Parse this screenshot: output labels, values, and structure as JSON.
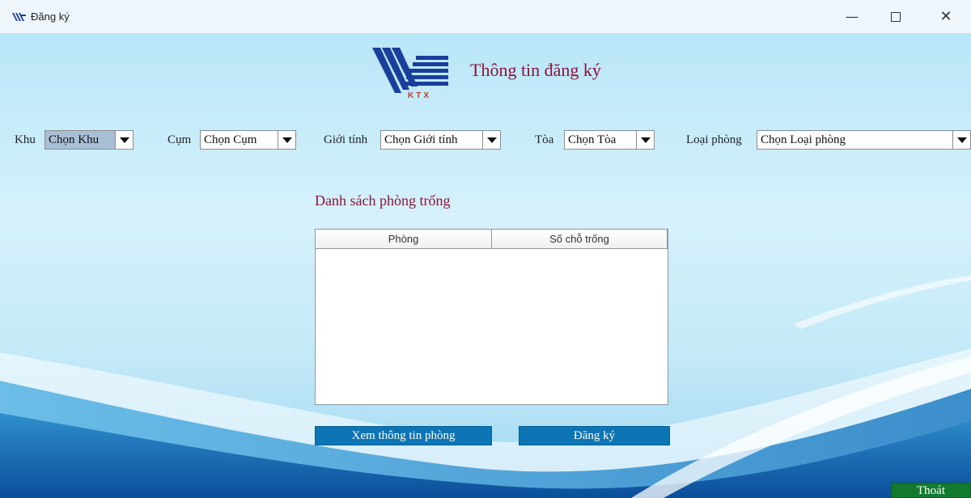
{
  "window": {
    "title": "Đăng ký",
    "min_icon": "minimize-icon",
    "max_icon": "maximize-icon",
    "close_icon": "close-icon",
    "min_glyph": "—",
    "close_glyph": "✕"
  },
  "header": {
    "logo_text": "KTX",
    "title": "Thông tin đăng ký"
  },
  "filters": {
    "khu": {
      "label": "Khu",
      "value": "Chọn Khu"
    },
    "cum": {
      "label": "Cụm",
      "value": "Chọn Cụm"
    },
    "gioi_tinh": {
      "label": "Giới tính",
      "value": "Chọn Giới tính"
    },
    "toa": {
      "label": "Tòa",
      "value": "Chọn Tòa"
    },
    "loai_phong": {
      "label": "Loại phòng",
      "value": "Chọn Loại phòng"
    }
  },
  "rooms": {
    "title": "Danh sách phòng trống",
    "columns": [
      "Phòng",
      "Số chỗ trống"
    ],
    "rows": []
  },
  "actions": {
    "view_label": "Xem thông tin phòng",
    "register_label": "Đăng ký",
    "exit_label": "Thoát"
  },
  "colors": {
    "accent": "#8a1538",
    "button_blue": "#0d75b3",
    "exit_green": "#127a2d"
  }
}
